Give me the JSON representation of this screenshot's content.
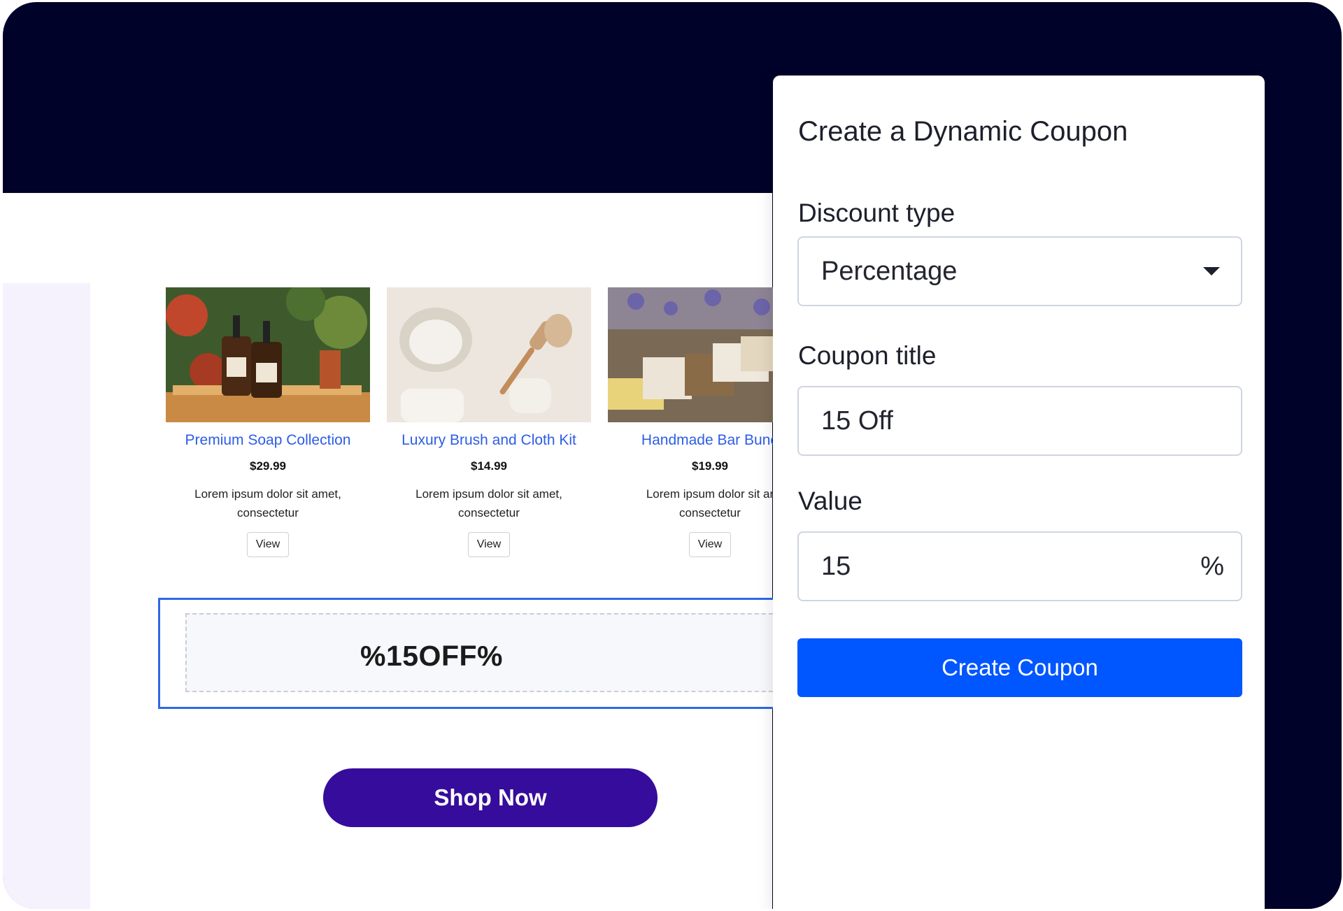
{
  "products": [
    {
      "name": "Premium Soap Collection",
      "price": "$29.99",
      "description": "Lorem ipsum dolor sit amet, consectetur",
      "view_label": "View"
    },
    {
      "name": "Luxury Brush and Cloth Kit",
      "price": "$14.99",
      "description": "Lorem ipsum dolor sit amet, consectetur",
      "view_label": "View"
    },
    {
      "name": "Handmade Bar Bund",
      "price": "$19.99",
      "description": "Lorem ipsum dolor sit ar consectetur",
      "view_label": "View"
    }
  ],
  "coupon_block": {
    "code": "%15OFF%"
  },
  "shop_button": {
    "label": "Shop Now"
  },
  "panel": {
    "title": "Create a Dynamic Coupon",
    "discount_type": {
      "label": "Discount type",
      "value": "Percentage"
    },
    "coupon_title": {
      "label": "Coupon title",
      "value": "15 Off"
    },
    "value": {
      "label": "Value",
      "value": "15",
      "suffix": "%"
    },
    "create_button": "Create Coupon"
  },
  "colors": {
    "frame_background": "#000229",
    "link_blue": "#2d5de6",
    "coupon_border": "#2f67e8",
    "shop_button": "#360c9c",
    "primary_button": "#0056ff",
    "left_strip": "#f5f2fe"
  }
}
